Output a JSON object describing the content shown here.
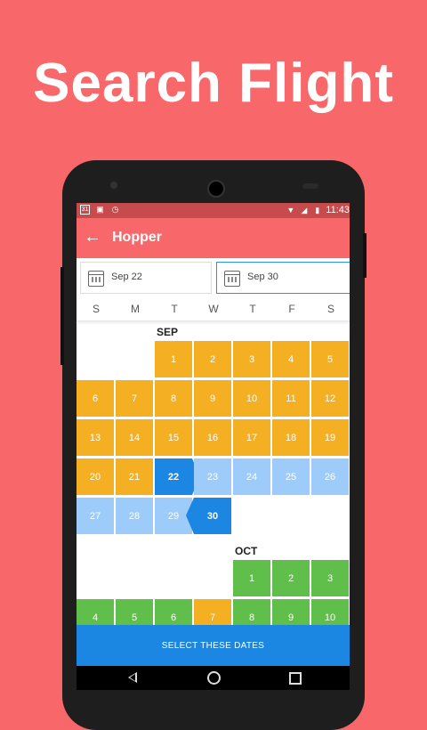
{
  "headline": "Search Flight",
  "status_bar": {
    "left_icons": [
      "calendar-status-icon",
      "image-status-icon",
      "alarm-status-icon"
    ],
    "calendar_day": "31",
    "time": "11:43"
  },
  "app_bar": {
    "title": "Hopper"
  },
  "date_fields": [
    {
      "label": "Sep 22"
    },
    {
      "label": "Sep 30"
    }
  ],
  "weekdays": [
    "S",
    "M",
    "T",
    "W",
    "T",
    "F",
    "S"
  ],
  "months": [
    {
      "name": "SEP",
      "rows": [
        [
          null,
          null,
          {
            "d": "1",
            "s": "o"
          },
          {
            "d": "2",
            "s": "o"
          },
          {
            "d": "3",
            "s": "o"
          },
          {
            "d": "4",
            "s": "o"
          },
          {
            "d": "5",
            "s": "o"
          }
        ],
        [
          {
            "d": "6",
            "s": "o"
          },
          {
            "d": "7",
            "s": "o"
          },
          {
            "d": "8",
            "s": "o"
          },
          {
            "d": "9",
            "s": "o"
          },
          {
            "d": "10",
            "s": "o"
          },
          {
            "d": "11",
            "s": "o"
          },
          {
            "d": "12",
            "s": "o"
          }
        ],
        [
          {
            "d": "13",
            "s": "o"
          },
          {
            "d": "14",
            "s": "o"
          },
          {
            "d": "15",
            "s": "o"
          },
          {
            "d": "16",
            "s": "o"
          },
          {
            "d": "17",
            "s": "o"
          },
          {
            "d": "18",
            "s": "o"
          },
          {
            "d": "19",
            "s": "o"
          }
        ],
        [
          {
            "d": "20",
            "s": "o"
          },
          {
            "d": "21",
            "s": "o"
          },
          {
            "d": "22",
            "s": "start"
          },
          {
            "d": "23",
            "s": "b"
          },
          {
            "d": "24",
            "s": "b"
          },
          {
            "d": "25",
            "s": "b"
          },
          {
            "d": "26",
            "s": "b"
          }
        ],
        [
          {
            "d": "27",
            "s": "b"
          },
          {
            "d": "28",
            "s": "b"
          },
          {
            "d": "29",
            "s": "b"
          },
          {
            "d": "30",
            "s": "end"
          },
          null,
          null,
          null
        ]
      ]
    },
    {
      "name": "OCT",
      "rows": [
        [
          null,
          null,
          null,
          null,
          {
            "d": "1",
            "s": "g"
          },
          {
            "d": "2",
            "s": "g"
          },
          {
            "d": "3",
            "s": "g"
          }
        ],
        [
          {
            "d": "4",
            "s": "g"
          },
          {
            "d": "5",
            "s": "g"
          },
          {
            "d": "6",
            "s": "g"
          },
          {
            "d": "7",
            "s": "o"
          },
          {
            "d": "8",
            "s": "g"
          },
          {
            "d": "9",
            "s": "g"
          },
          {
            "d": "10",
            "s": "g"
          }
        ]
      ]
    }
  ],
  "select_button": {
    "label": "SELECT THESE DATES"
  },
  "colors": {
    "background": "#F8686A",
    "status_bar": "#C74B4C",
    "orange": "#F4B022",
    "green": "#5FBF4A",
    "light_blue": "#9DCCFB",
    "selected_blue": "#1C86E3"
  }
}
